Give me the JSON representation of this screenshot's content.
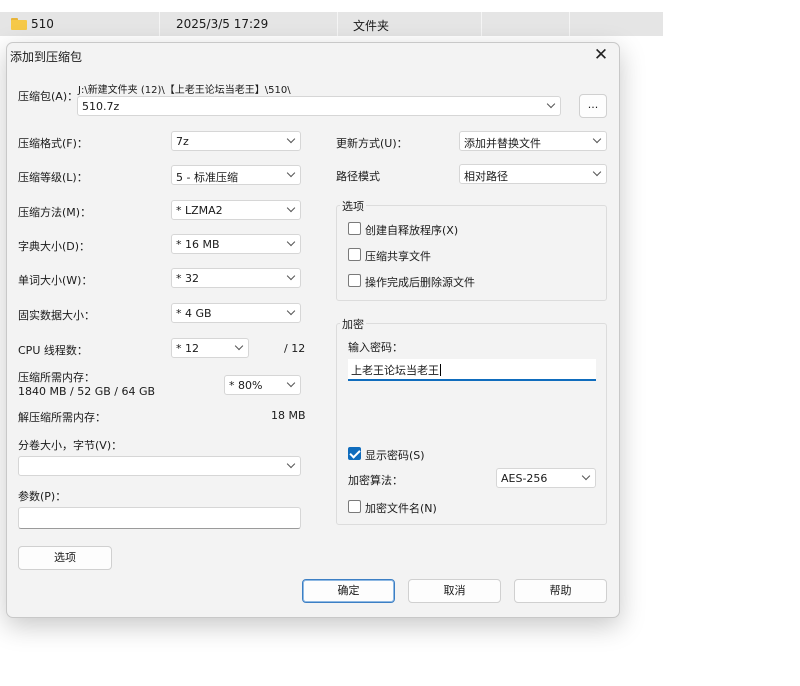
{
  "explorer": {
    "name": "510",
    "date": "2025/3/5 17:29",
    "type": "文件夹"
  },
  "dialog": {
    "title": "添加到压缩包",
    "archive_label": "压缩包(A)：",
    "archive_path": "J:\\新建文件夹 (12)\\【上老王论坛当老王】\\510\\",
    "archive_name": "510.7z",
    "browse_label": "...",
    "left": {
      "format_label": "压缩格式(F)：",
      "format_value": "7z",
      "level_label": "压缩等级(L)：",
      "level_value": "5 - 标准压缩",
      "method_label": "压缩方法(M)：",
      "method_value": "* LZMA2",
      "dict_label": "字典大小(D)：",
      "dict_value": "* 16 MB",
      "word_label": "单词大小(W)：",
      "word_value": "* 32",
      "solid_label": "固实数据大小：",
      "solid_value": "* 4 GB",
      "cpu_label": "CPU 线程数：",
      "cpu_value": "* 12",
      "cpu_total": "/ 12",
      "mem_label": "压缩所需内存：",
      "mem_detail": "1840 MB / 52 GB / 64 GB",
      "mem_value": "* 80%",
      "decomp_label": "解压缩所需内存：",
      "decomp_value": "18 MB",
      "volume_label": "分卷大小，字节(V)：",
      "volume_value": "",
      "params_label": "参数(P)：",
      "params_value": ""
    },
    "right": {
      "update_label": "更新方式(U)：",
      "update_value": "添加并替换文件",
      "path_label": "路径模式",
      "path_value": "相对路径",
      "options_title": "选项",
      "opt_sfx": "创建自释放程序(X)",
      "opt_shared": "压缩共享文件",
      "opt_delete": "操作完成后删除源文件",
      "encrypt_title": "加密",
      "password_label": "输入密码：",
      "password_value": "上老王论坛当老王",
      "show_password": "显示密码(S)",
      "algo_label": "加密算法：",
      "algo_value": "AES-256",
      "encrypt_names": "加密文件名(N)"
    },
    "options_button": "选项",
    "ok": "确定",
    "cancel": "取消",
    "help": "帮助"
  }
}
